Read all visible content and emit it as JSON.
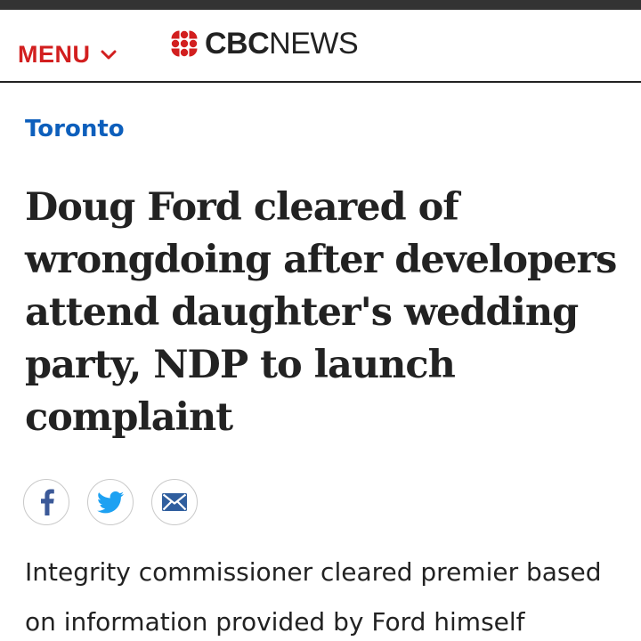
{
  "header": {
    "menu_label": "MENU",
    "menu_chevron_icon": "chevron-down-icon",
    "logo": {
      "gem_icon": "cbc-gem-icon",
      "cbc": "CBC",
      "news": "NEWS"
    }
  },
  "article": {
    "section": "Toronto",
    "headline": "Doug Ford cleared of wrongdoing after developers attend daughter's wedding party, NDP to launch complaint",
    "deck": "Integrity commissioner cleared premier based on information provided by Ford himself"
  },
  "share": [
    {
      "icon": "facebook-icon"
    },
    {
      "icon": "twitter-icon"
    },
    {
      "icon": "email-icon"
    }
  ],
  "colors": {
    "brand_red": "#d21f1f",
    "section_blue": "#0d5fbc",
    "text": "#222222",
    "twitter_blue": "#1da1f2",
    "facebook_blue": "#3b5998"
  }
}
